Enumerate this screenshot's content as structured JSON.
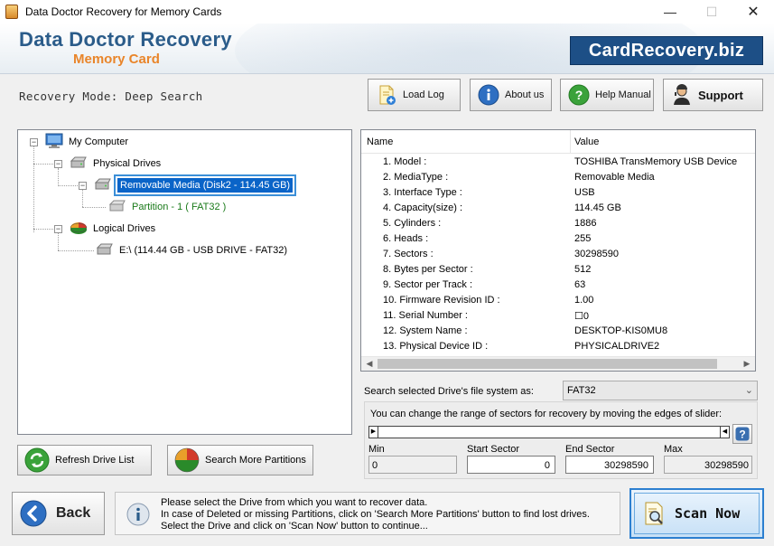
{
  "window": {
    "title": "Data Doctor Recovery for Memory Cards",
    "controls": {
      "minimize": "—",
      "maximize": "☐",
      "close": "✕"
    }
  },
  "header": {
    "brand_title": "Data Doctor Recovery",
    "brand_subtitle": "Memory Card",
    "site_badge": "CardRecovery.biz"
  },
  "toolbar": {
    "recovery_mode": "Recovery Mode: Deep Search",
    "load_log": "Load Log",
    "about_us": "About us",
    "help_manual": "Help Manual",
    "support": "Support"
  },
  "tree": {
    "root": "My Computer",
    "physical_drives": "Physical Drives",
    "removable_media": "Removable Media (Disk2 - 114.45 GB)",
    "partition": "Partition - 1 ( FAT32 )",
    "logical_drives": "Logical Drives",
    "logical_drive_e": "E:\\ (114.44 GB - USB DRIVE - FAT32)",
    "expander_minus": "−"
  },
  "properties": {
    "col_name": "Name",
    "col_value": "Value",
    "rows": [
      {
        "name": "1. Model :",
        "value": "TOSHIBA TransMemory USB Device"
      },
      {
        "name": "2. MediaType :",
        "value": "Removable Media"
      },
      {
        "name": "3. Interface Type :",
        "value": "USB"
      },
      {
        "name": "4. Capacity(size) :",
        "value": "114.45 GB"
      },
      {
        "name": "5. Cylinders :",
        "value": "1886"
      },
      {
        "name": "6. Heads :",
        "value": "255"
      },
      {
        "name": "7. Sectors :",
        "value": "30298590"
      },
      {
        "name": "8. Bytes per Sector :",
        "value": "512"
      },
      {
        "name": "9. Sector per Track :",
        "value": "63"
      },
      {
        "name": "10. Firmware Revision ID :",
        "value": "1.00"
      },
      {
        "name": "11. Serial Number :",
        "value": "☐0"
      },
      {
        "name": "12. System Name :",
        "value": "DESKTOP-KIS0MU8"
      },
      {
        "name": "13. Physical Device ID :",
        "value": "PHYSICALDRIVE2"
      }
    ],
    "scroll_left": "◀",
    "scroll_right": "▶"
  },
  "filesystem": {
    "label": "Search selected Drive's file system as:",
    "selected": "FAT32",
    "chevron": "⌄"
  },
  "slider": {
    "instruction": "You can change the range of sectors for recovery by moving the edges of slider:",
    "left_cap": "▶",
    "right_cap": "◀",
    "help": "?",
    "min_label": "Min",
    "min_value": "0",
    "start_label": "Start Sector",
    "start_value": "0",
    "end_label": "End Sector",
    "end_value": "30298590",
    "max_label": "Max",
    "max_value": "30298590"
  },
  "actions": {
    "refresh": "Refresh Drive List",
    "search_more": "Search More Partitions",
    "back": "Back",
    "scan_now": "Scan Now"
  },
  "message": {
    "line1": "Please select the Drive from which you want to recover data.",
    "line2": "In case of Deleted or missing Partitions, click on 'Search More Partitions' button to find lost drives.",
    "line3": "Select the Drive and click on 'Scan Now' button to continue..."
  },
  "colors": {
    "brand_blue": "#2b5c8a",
    "brand_orange": "#e9852a",
    "badge_bg": "#1d4f86",
    "selection": "#0a64c8",
    "partition_text": "#1a7a1a"
  },
  "icons": {
    "app": "app-icon",
    "load_log": "document-add-icon",
    "about": "info-icon",
    "help": "question-icon",
    "support": "person-icon",
    "computer": "computer-icon",
    "drive": "drive-icon",
    "logical": "pie-chart-icon",
    "refresh": "refresh-icon",
    "search_more": "pie-chart-icon",
    "back": "back-arrow-icon",
    "info": "info-icon",
    "scan": "magnifier-document-icon"
  }
}
